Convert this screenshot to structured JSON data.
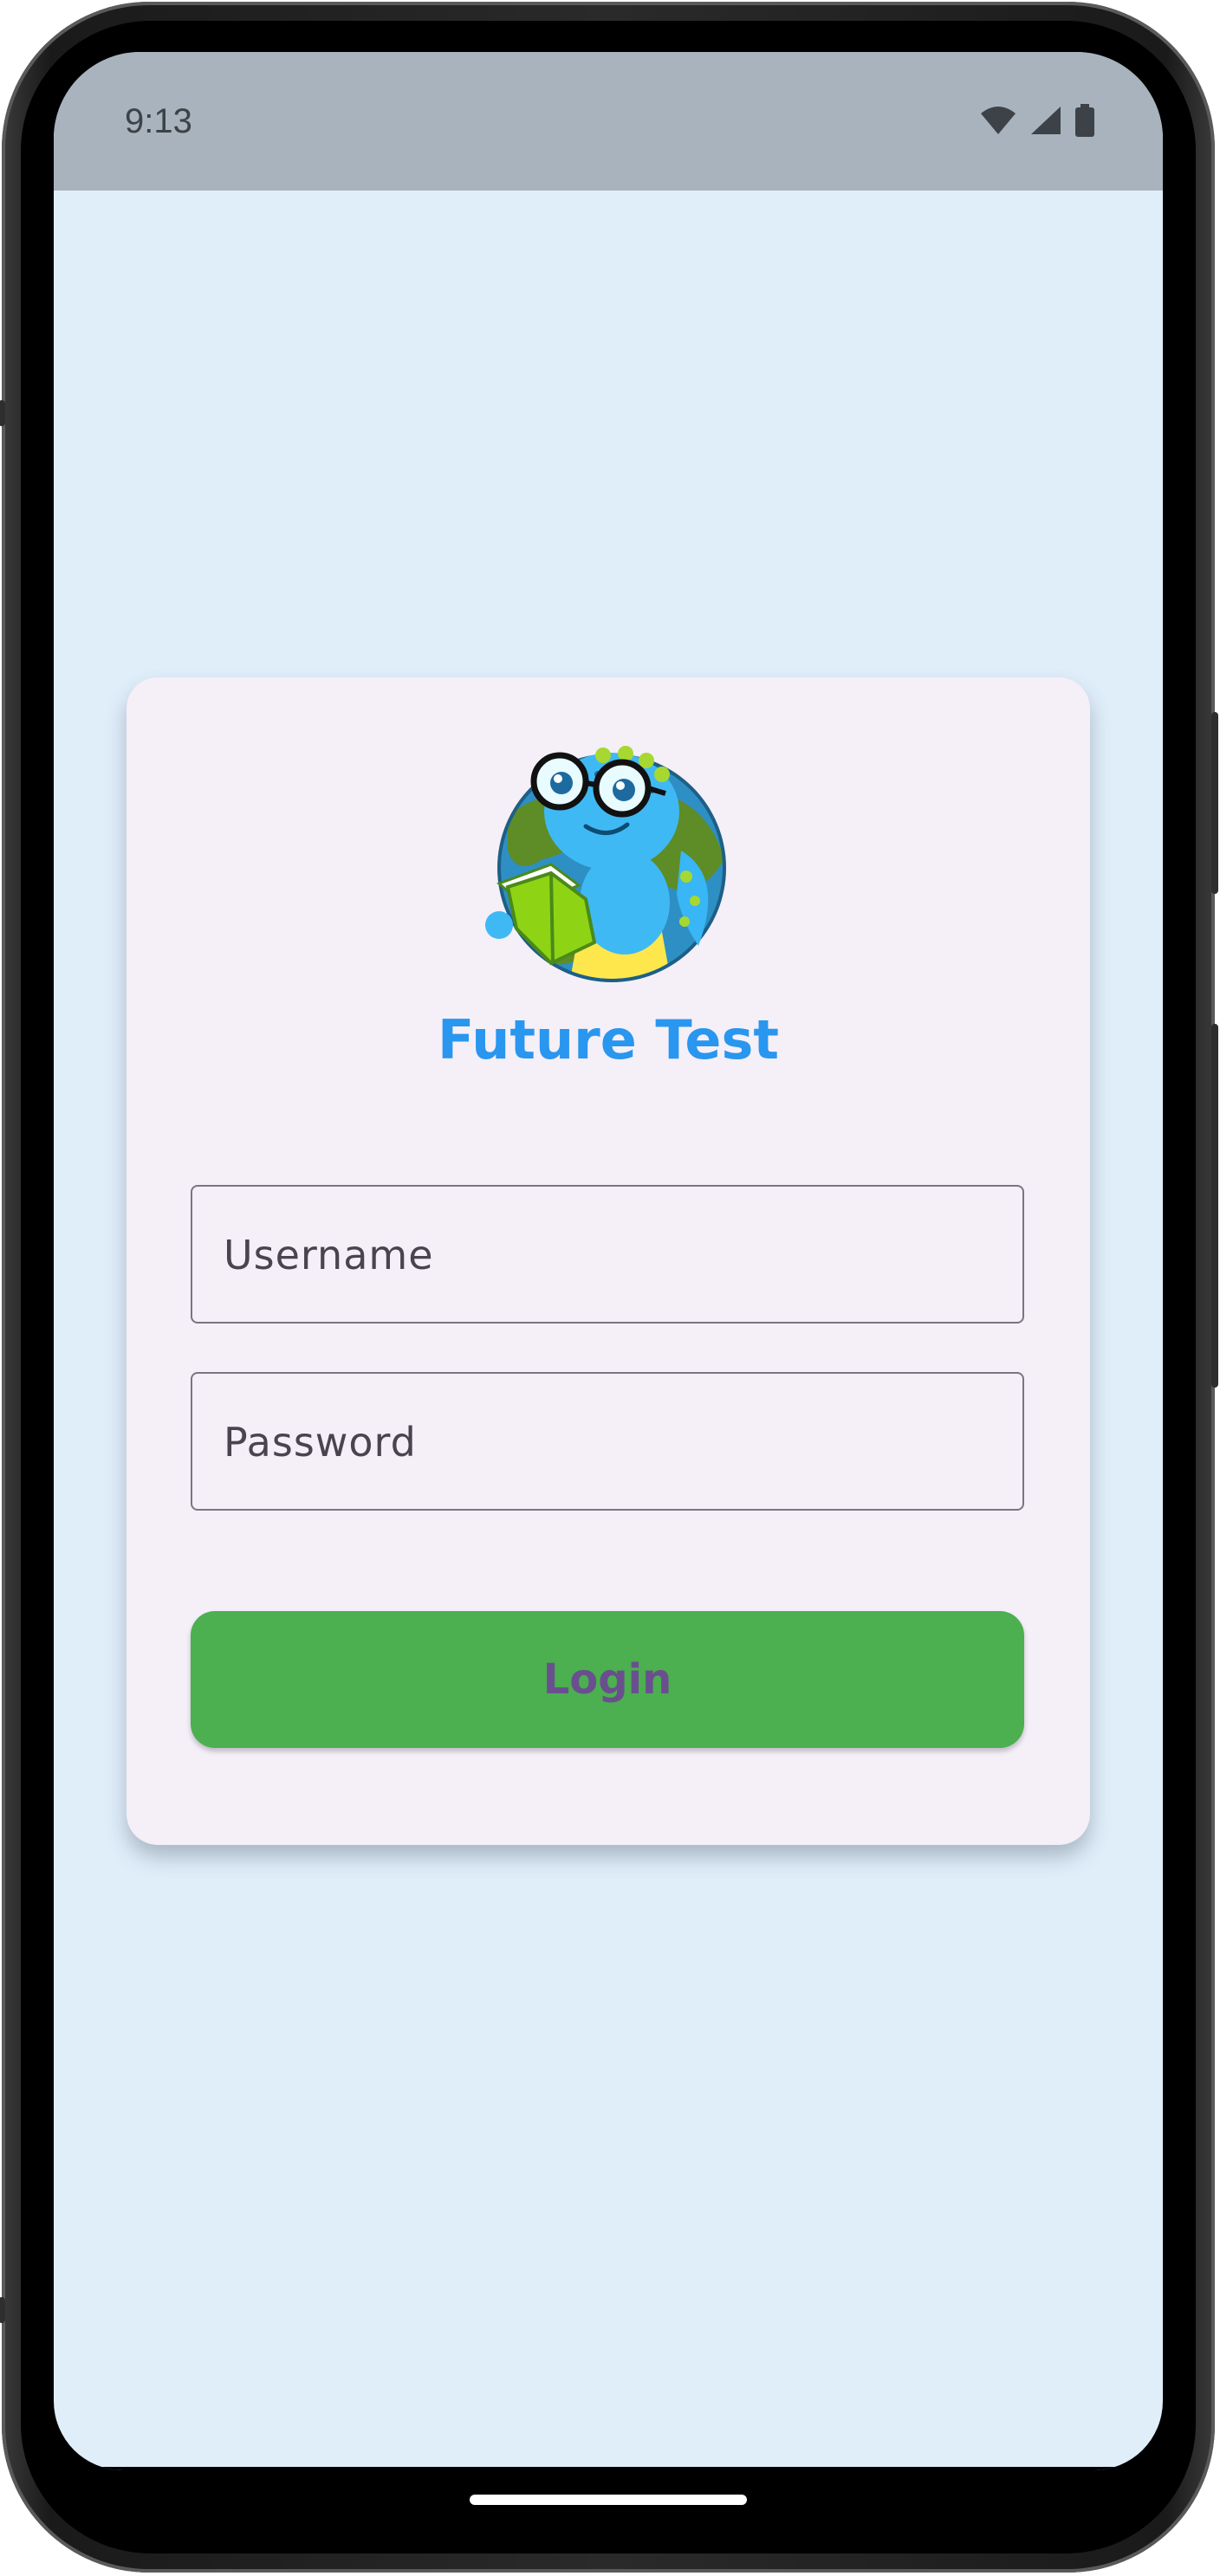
{
  "status_bar": {
    "time": "9:13",
    "icons": [
      "wifi-icon",
      "cellular-signal-icon",
      "battery-icon"
    ]
  },
  "login": {
    "app_name": "Future Test",
    "logo": "dinosaur-reading-book-logo",
    "username_placeholder": "Username",
    "username_value": "",
    "password_placeholder": "Password",
    "password_value": "",
    "login_label": "Login"
  },
  "colors": {
    "background": "#e0eefa",
    "card": "#f5eff8",
    "title": "#2996ef",
    "button": "#4caf50",
    "button_text": "#6a4f8f",
    "status_bar": "#a8b3bd"
  }
}
